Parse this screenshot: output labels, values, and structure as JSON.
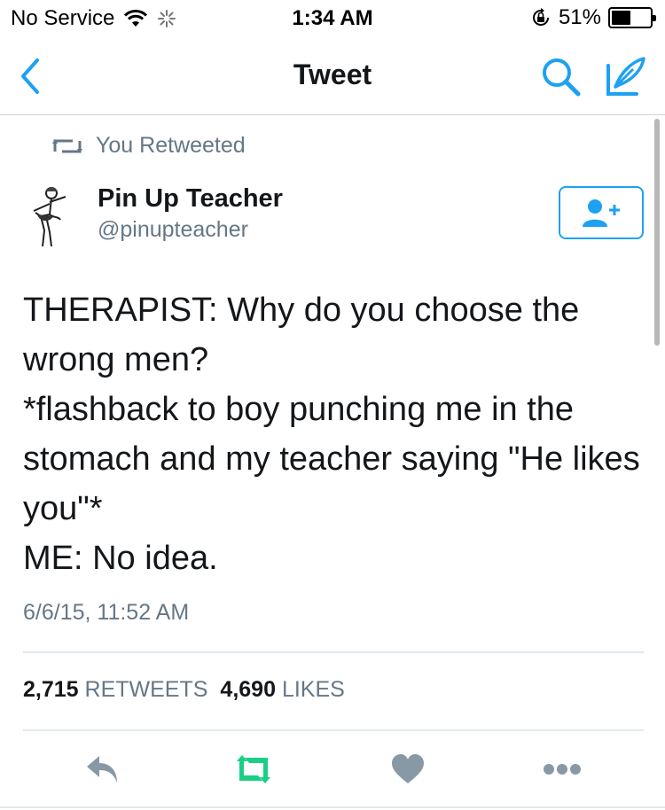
{
  "status_bar": {
    "carrier": "No Service",
    "time": "1:34 AM",
    "battery_percent": "51%",
    "battery_level": 0.51
  },
  "nav": {
    "title": "Tweet",
    "back_icon": "chevron-left-icon",
    "search_icon": "search-icon",
    "compose_icon": "compose-icon"
  },
  "tweet": {
    "retweet_context": "You Retweeted",
    "author_name": "Pin Up Teacher",
    "author_handle": "@pinupteacher",
    "text": "THERAPIST: Why do you choose the wrong men?\n*flashback to boy punching me in the stomach and my teacher saying \"He likes you\"*\nME: No idea.",
    "timestamp": "6/6/15, 11:52 AM",
    "retweets_count": "2,715",
    "retweets_label": "RETWEETS",
    "likes_count": "4,690",
    "likes_label": "LIKES"
  },
  "colors": {
    "accent": "#1da1f2",
    "retweet_green": "#19cf86",
    "muted": "#657786",
    "action_gray": "#8899a6"
  }
}
